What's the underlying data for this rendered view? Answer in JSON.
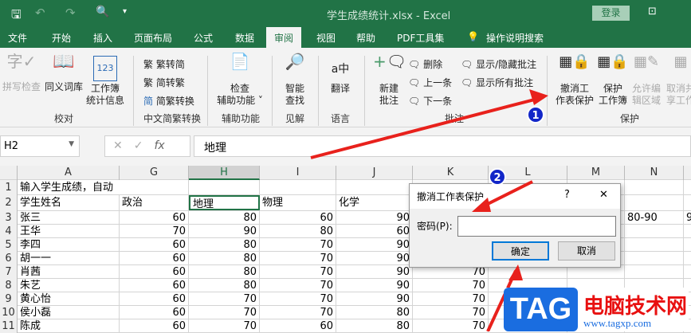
{
  "titlebar": {
    "title": "学生成绩统计.xlsx  -  Excel",
    "login": "登录",
    "qat_more": "▾"
  },
  "tabs": [
    "文件",
    "开始",
    "插入",
    "页面布局",
    "公式",
    "数据",
    "审阅",
    "视图",
    "帮助",
    "PDF工具集",
    "操作说明搜索"
  ],
  "active_tab": "审阅",
  "ribbon": {
    "proofing": {
      "label": "校对",
      "spell": "拼写检查",
      "thesaurus": "同义词库",
      "stats1": "工作簿",
      "stats2": "统计信息"
    },
    "chinese": {
      "label": "中文简繁转换",
      "t2s": "繁转简",
      "s2t": "简转繁",
      "conv": "简繁转换"
    },
    "access": {
      "label": "辅助功能",
      "check1": "检查",
      "check2": "辅助功能 ˅"
    },
    "insights": {
      "label": "见解",
      "smart1": "智能",
      "smart2": "查找"
    },
    "language": {
      "label": "语言",
      "translate": "翻译"
    },
    "comments": {
      "label": "批注",
      "new1": "新建",
      "new2": "批注",
      "delete": "删除",
      "prev": "上一条",
      "next": "下一条",
      "showhide": "显示/隐藏批注",
      "showall": "显示所有批注"
    },
    "protect": {
      "label": "保护",
      "unprotect1": "撤消工",
      "unprotect2": "作表保护",
      "protectwb1": "保护",
      "protectwb2": "工作簿",
      "allow1": "允许编",
      "allow2": "辑区域",
      "unshare1": "取消共",
      "unshare2": "享工作"
    }
  },
  "formula_bar": {
    "namebox": "H2",
    "content": "地理",
    "fx": "fx"
  },
  "columns": [
    "A",
    "G",
    "H",
    "I",
    "J",
    "K",
    "L",
    "M",
    "N"
  ],
  "rows": [
    {
      "n": "1",
      "cells": [
        "输入学生成绩，自动",
        "",
        "",
        "",
        "",
        "",
        "",
        "",
        ""
      ]
    },
    {
      "n": "2",
      "cells": [
        "学生姓名",
        "政治",
        "地理",
        "物理",
        "化学",
        "",
        "",
        "",
        ""
      ]
    },
    {
      "n": "3",
      "cells": [
        "张三",
        "60",
        "80",
        "60",
        "90",
        "",
        "",
        "",
        "80-90"
      ]
    },
    {
      "n": "4",
      "cells": [
        "王华",
        "70",
        "90",
        "80",
        "60",
        "",
        "",
        "",
        ""
      ]
    },
    {
      "n": "5",
      "cells": [
        "李四",
        "60",
        "80",
        "70",
        "90",
        "",
        "",
        "",
        ""
      ]
    },
    {
      "n": "6",
      "cells": [
        "胡一一",
        "60",
        "80",
        "70",
        "90",
        "",
        "",
        "",
        ""
      ]
    },
    {
      "n": "7",
      "cells": [
        "肖茜",
        "60",
        "80",
        "70",
        "90",
        "70",
        "",
        "",
        ""
      ]
    },
    {
      "n": "8",
      "cells": [
        "朱艺",
        "60",
        "80",
        "70",
        "90",
        "70",
        "",
        "",
        ""
      ]
    },
    {
      "n": "9",
      "cells": [
        "黄心怡",
        "60",
        "70",
        "70",
        "90",
        "70",
        "",
        "",
        ""
      ]
    },
    {
      "n": "10",
      "cells": [
        "侯小磊",
        "60",
        "70",
        "70",
        "80",
        "70",
        "",
        "",
        ""
      ]
    },
    {
      "n": "11",
      "cells": [
        "陈成",
        "60",
        "70",
        "60",
        "80",
        "70",
        "",
        "",
        ""
      ]
    }
  ],
  "overflow_n_col": "9",
  "dialog": {
    "title": "撤消工作表保护",
    "help": "?",
    "close": "✕",
    "password_label": "密码(P):",
    "password_value": "",
    "ok": "确定",
    "cancel": "取消"
  },
  "annotations": {
    "step1": "1",
    "step2": "2",
    "arrow_color": "#e8211c"
  },
  "watermark": {
    "logo": "TAG",
    "brand": "电脑技术网",
    "url": "www.tagxp.com"
  }
}
